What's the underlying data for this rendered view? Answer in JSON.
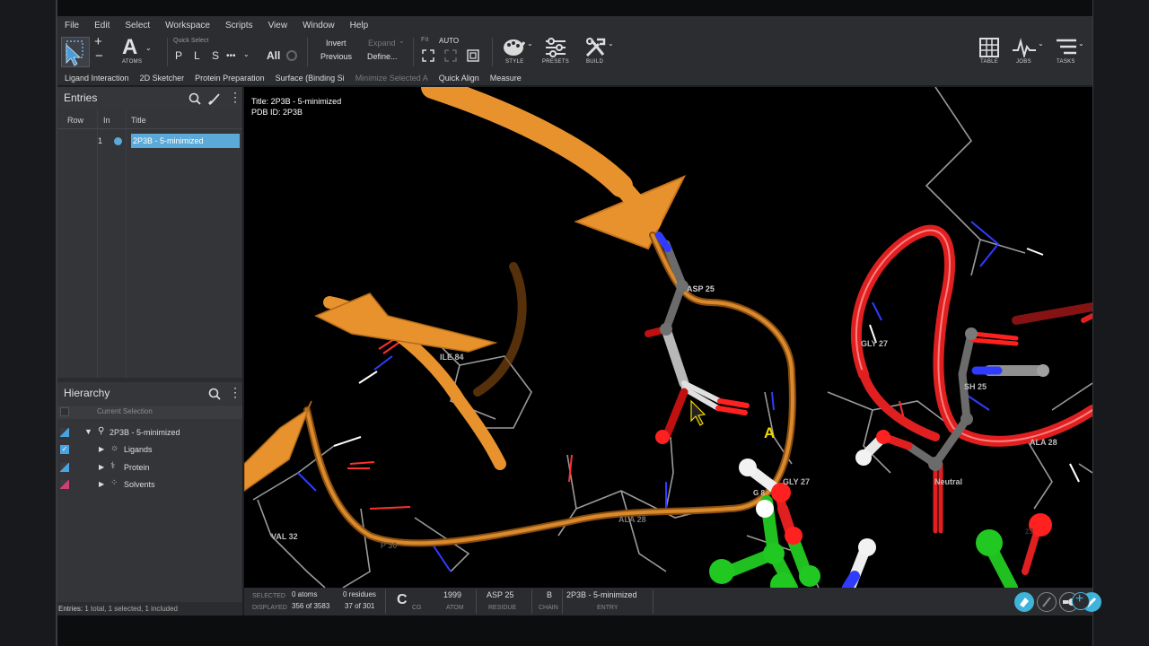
{
  "menu": [
    "File",
    "Edit",
    "Select",
    "Workspace",
    "Scripts",
    "View",
    "Window",
    "Help"
  ],
  "toolbar": {
    "atoms_label": "ATOMS",
    "quick_select_label": "Quick Select",
    "quick_p": "P",
    "quick_l": "L",
    "quick_s": "S",
    "quick_more": "•••",
    "all_label": "All",
    "invert_label": "Invert",
    "previous_label": "Previous",
    "expand_label": "Expand",
    "define_label": "Define...",
    "fit_label": "Fit",
    "auto_label": "AUTO",
    "style_label": "STYLE",
    "presets_label": "PRESETS",
    "build_label": "BUILD",
    "table_label": "TABLE",
    "jobs_label": "JOBS",
    "tasks_label": "TASKS"
  },
  "second_toolbar": {
    "items": [
      "Ligand Interaction",
      "2D Sketcher",
      "Protein Preparation",
      "Surface (Binding Si",
      "Minimize Selected A",
      "Quick Align",
      "Measure"
    ],
    "disabled_index": 4
  },
  "entries": {
    "title": "Entries",
    "columns": [
      "Row",
      "In",
      "Title"
    ],
    "rows": [
      {
        "row": "1",
        "title": "2P3B - 5-minimized"
      }
    ]
  },
  "hierarchy": {
    "title": "Hierarchy",
    "current_selection": "Current Selection",
    "root": "2P3B - 5-minimized",
    "children": [
      "Ligands",
      "Protein",
      "Solvents"
    ]
  },
  "status_left": {
    "label": "Entries:",
    "text": "1 total, 1 selected, 1 included"
  },
  "viewport": {
    "title_line": "Title: 2P3B - 5-minimized",
    "pdb_line": "PDB ID: 2P3B",
    "residue_labels": [
      "ASP 25",
      "GLY 27",
      "ILE 84",
      "SH 25",
      "ALA 28",
      "GLY 27",
      "Neutral",
      "VAL 32",
      "P 30",
      "ALA 28",
      "G 8",
      "23"
    ],
    "pick_marker": "A"
  },
  "statusbar": {
    "selected_label": "SELECTED",
    "displayed_label": "DISPLAYED",
    "selected_atoms": "0 atoms",
    "selected_residues": "0 residues",
    "displayed_atoms": "356 of 3583",
    "displayed_residues": "37 of 301",
    "element": "C",
    "element_sub": "CG",
    "atom_value": "1999",
    "atom_label": "ATOM",
    "residue_value": "ASP 25",
    "residue_label": "RESIDUE",
    "chain_value": "B",
    "chain_label": "CHAIN",
    "entry_value": "2P3B - 5-minimized",
    "entry_label": "ENTRY"
  },
  "colors": {
    "selection_blue": "#5aa9d8",
    "ribbon_orange": "#e8922e",
    "ribbon_red": "#e02020",
    "accent_cyan": "#3fb3d9"
  }
}
